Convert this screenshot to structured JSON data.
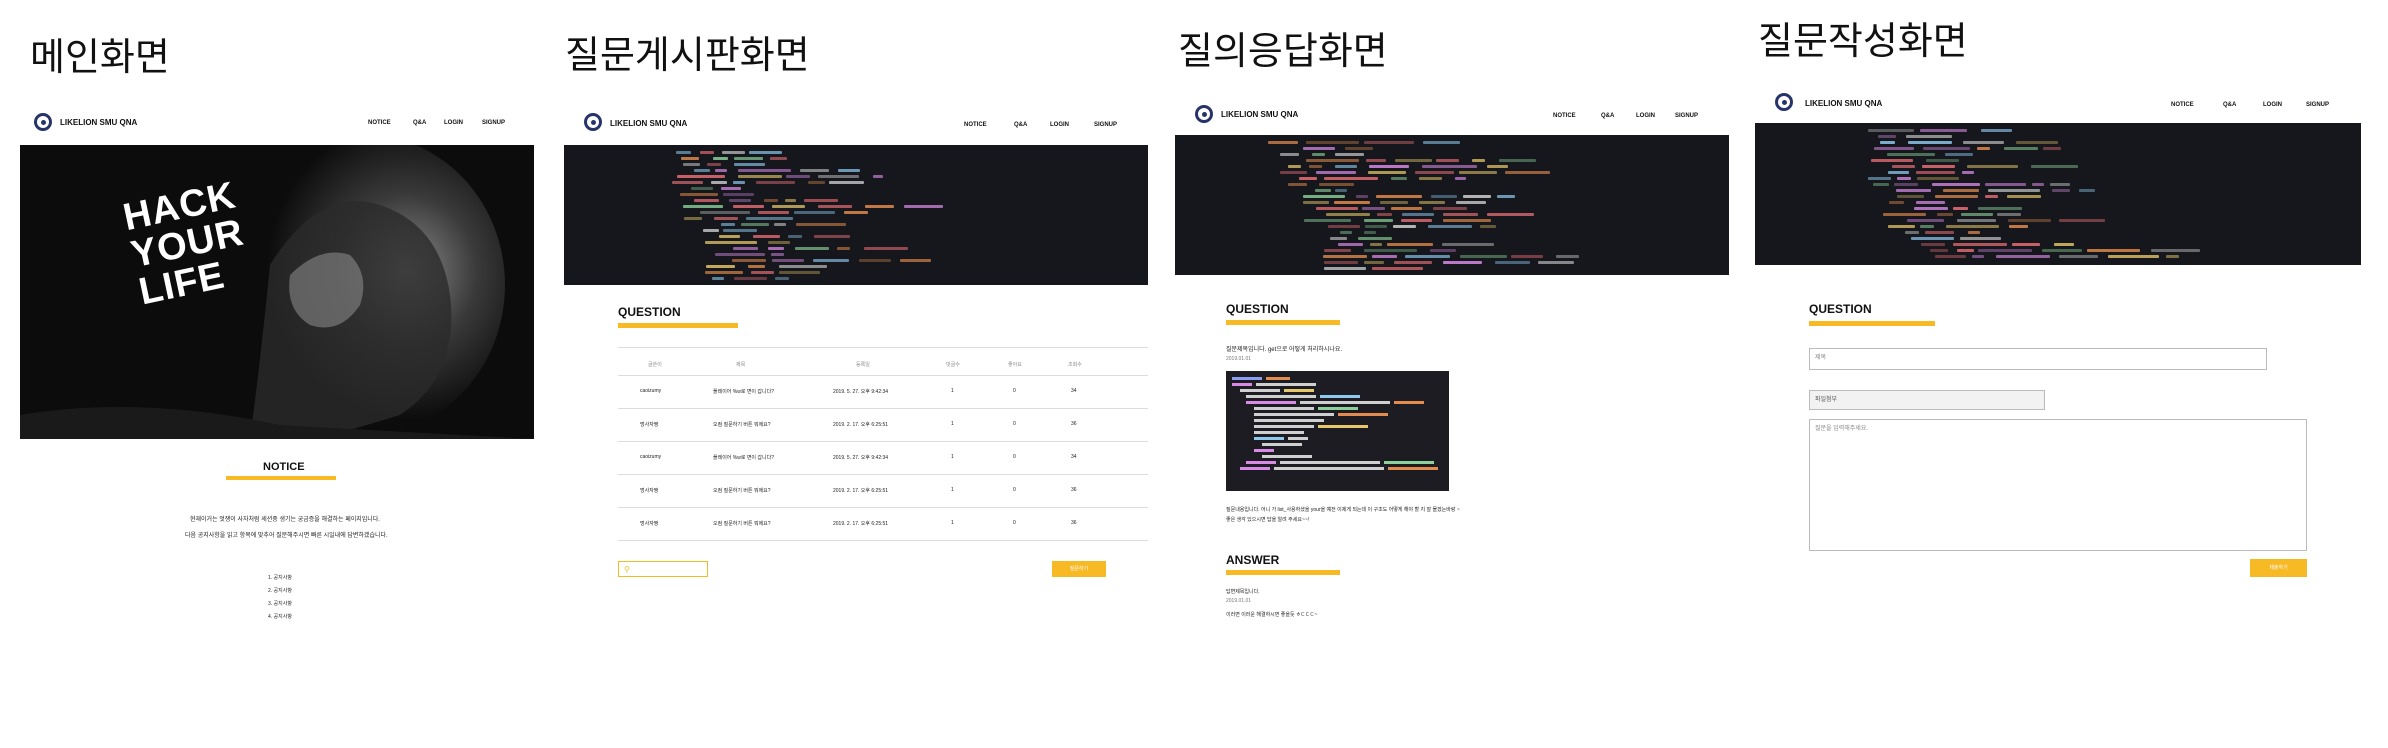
{
  "labels": [
    "메인화면",
    "질문게시판화면",
    "질의응답화면",
    "질문작성화면"
  ],
  "nav": {
    "brand": "LIKELION SMU QNA",
    "items": [
      "NOTICE",
      "Q&A",
      "LOGIN",
      "SIGNUP"
    ]
  },
  "main": {
    "hero": [
      "HACK",
      "YOUR",
      "LIFE"
    ],
    "notice_title": "NOTICE",
    "notice_text": [
      "현재이거는 멋쟁이 사자처럼 세션중 생기는 궁금증을 해결하는 페이지입니다.",
      "다음 공지사항을 읽고 항목에 맞추어 질문해주시면 빠른 시일내에 답변하겠습니다."
    ],
    "notice_items": [
      "1. 공지사항",
      "2. 공지사항",
      "3. 공지사항",
      "4. 공지사항"
    ]
  },
  "board": {
    "title": "QUESTION",
    "headers": [
      "글쓴이",
      "제목",
      "등록일",
      "댓글수",
      "좋아요",
      "조회수"
    ],
    "rows": [
      [
        "caoizumy",
        "플레이어 %w로 면이 갑니다?",
        "2019. 5. 27. 오후 9:42:34",
        "1",
        "0",
        "34"
      ],
      [
        "멍사자짱",
        "오컴 질문하기 버튼 뭐에요?",
        "2019. 2. 17. 오후 6:25:51",
        "1",
        "0",
        "36"
      ],
      [
        "caoizumy",
        "플레이어 %w로 면이 갑니다?",
        "2019. 5. 27. 오후 9:42:34",
        "1",
        "0",
        "34"
      ],
      [
        "멍사자짱",
        "오컴 질문하기 버튼 뭐에요?",
        "2019. 2. 17. 오후 6:25:51",
        "1",
        "0",
        "36"
      ],
      [
        "멍사자짱",
        "오컴 질문하기 버튼 뭐에요?",
        "2019. 2. 17. 오후 6:25:51",
        "1",
        "0",
        "36"
      ]
    ],
    "write_button": "질문하기"
  },
  "qa": {
    "question_title": "QUESTION",
    "question_text": "질문제목입니다. get으로 어떻게 처리하시나요.",
    "question_date": "2019.01.01",
    "question_body": [
      "질문내용입니다. 어니 가 list_사용하셨을 your을 예전 이제게 되는데 이 구조도 어떻게 해야 할 지 잘 몰겠는바랑 ~",
      "좋은 생각 있으시면 답을 알려 주세요~~!"
    ],
    "answer_title": "ANSWER",
    "answer_label": "답변제목입니다.",
    "answer_date": "2019.01.01",
    "answer_text": "이러면 이러운 해결하시면 좋을듯 ㅎㄷㄷㄷ~"
  },
  "write": {
    "title": "QUESTION",
    "title_placeholder": "제목",
    "file_placeholder": "파일첨부",
    "body_placeholder": "질문을 입력해주세요.",
    "submit": "제출하기"
  }
}
